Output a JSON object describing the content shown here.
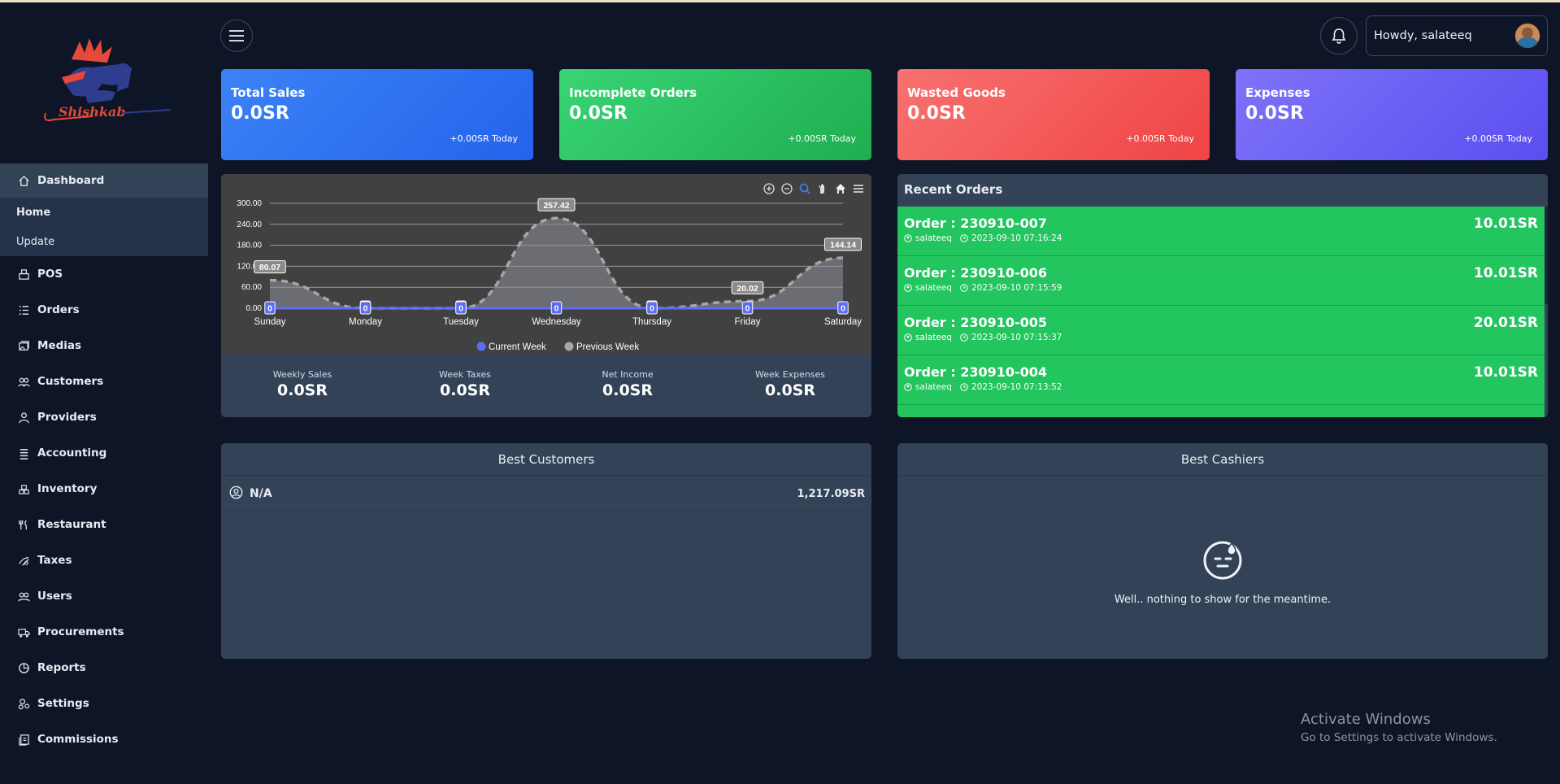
{
  "brand": {
    "logo_text": "Shishkab"
  },
  "sidebar": {
    "items": [
      {
        "label": "Dashboard",
        "icon": "home-icon"
      },
      {
        "label": "POS",
        "icon": "pos-icon"
      },
      {
        "label": "Orders",
        "icon": "list-icon"
      },
      {
        "label": "Medias",
        "icon": "images-icon"
      },
      {
        "label": "Customers",
        "icon": "users-icon"
      },
      {
        "label": "Providers",
        "icon": "user-icon"
      },
      {
        "label": "Accounting",
        "icon": "ledger-icon"
      },
      {
        "label": "Inventory",
        "icon": "inventory-icon"
      },
      {
        "label": "Restaurant",
        "icon": "utensils-icon"
      },
      {
        "label": "Taxes",
        "icon": "tax-icon"
      },
      {
        "label": "Users",
        "icon": "users-cog-icon"
      },
      {
        "label": "Procurements",
        "icon": "truck-icon"
      },
      {
        "label": "Reports",
        "icon": "pie-chart-icon"
      },
      {
        "label": "Settings",
        "icon": "cogs-icon"
      },
      {
        "label": "Commissions",
        "icon": "coins-icon"
      }
    ],
    "dashboard_sub": [
      {
        "label": "Home"
      },
      {
        "label": "Update"
      }
    ]
  },
  "header": {
    "greeting": "Howdy, salateeq"
  },
  "stats": [
    {
      "title": "Total Sales",
      "value": "0.0SR",
      "delta": "+0.00SR Today",
      "color": "#3b82f6"
    },
    {
      "title": "Incomplete Orders",
      "value": "0.0SR",
      "delta": "+0.00SR Today",
      "color": "#22c55e"
    },
    {
      "title": "Wasted Goods",
      "value": "0.0SR",
      "delta": "+0.00SR Today",
      "color": "#f87171"
    },
    {
      "title": "Expenses",
      "value": "0.0SR",
      "delta": "+0.00SR Today",
      "color": "#6d5ff5"
    }
  ],
  "chart_data": {
    "type": "area",
    "categories": [
      "Sunday",
      "Monday",
      "Tuesday",
      "Wednesday",
      "Thursday",
      "Friday",
      "Saturday"
    ],
    "series": [
      {
        "name": "Current Week",
        "values": [
          0,
          0,
          0,
          0,
          0,
          0,
          0
        ],
        "color": "#5b6ef5"
      },
      {
        "name": "Previous Week",
        "values": [
          80.07,
          0,
          0,
          257.42,
          0,
          20.02,
          144.14
        ],
        "color": "#9aa0a6"
      }
    ],
    "y_ticks": [
      "300.00",
      "240.00",
      "180.00",
      "120.00",
      "60.00",
      "0.00"
    ],
    "ylim": [
      0,
      300
    ],
    "data_labels": {
      "current": [
        "0",
        "0",
        "0",
        "0",
        "0",
        "0",
        "0"
      ],
      "previous": [
        "80.07",
        "0",
        "0",
        "257.42",
        "0",
        "20.02",
        "144.14"
      ]
    },
    "legend_position": "bottom-center",
    "grid": true
  },
  "summary": [
    {
      "label": "Weekly Sales",
      "value": "0.0SR"
    },
    {
      "label": "Week Taxes",
      "value": "0.0SR"
    },
    {
      "label": "Net Income",
      "value": "0.0SR"
    },
    {
      "label": "Week Expenses",
      "value": "0.0SR"
    }
  ],
  "recent_orders": {
    "title": "Recent Orders",
    "items": [
      {
        "code": "Order : 230910-007",
        "amount": "10.01SR",
        "author": "salateeq",
        "date": "2023-09-10 07:16:24"
      },
      {
        "code": "Order : 230910-006",
        "amount": "10.01SR",
        "author": "salateeq",
        "date": "2023-09-10 07:15:59"
      },
      {
        "code": "Order : 230910-005",
        "amount": "20.01SR",
        "author": "salateeq",
        "date": "2023-09-10 07:15:37"
      },
      {
        "code": "Order : 230910-004",
        "amount": "10.01SR",
        "author": "salateeq",
        "date": "2023-09-10 07:13:52"
      }
    ]
  },
  "best_customers": {
    "title": "Best Customers",
    "rows": [
      {
        "name": "N/A",
        "amount": "1,217.09SR"
      }
    ]
  },
  "best_cashiers": {
    "title": "Best Cashiers",
    "empty_message": "Well.. nothing to show for the meantime."
  },
  "watermark": {
    "line1": "Activate Windows",
    "line2": "Go to Settings to activate Windows."
  }
}
